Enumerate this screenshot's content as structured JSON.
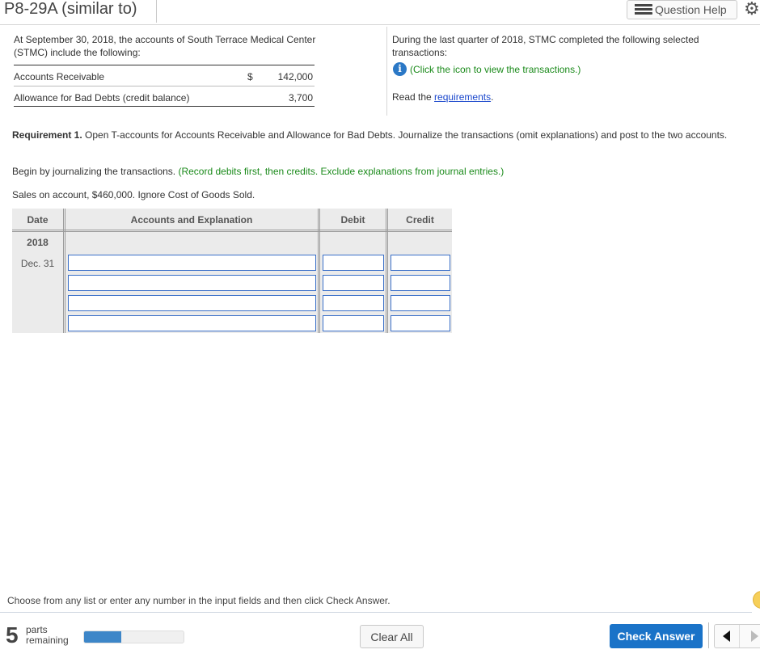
{
  "header": {
    "title": "P8-29A (similar to)",
    "question_help_label": "Question Help",
    "question_help_icon": "list-icon",
    "settings_icon": "gear-icon"
  },
  "left": {
    "intro": "At September 30, 2018, the accounts of South Terrace Medical Center (STMC) include the following:",
    "balances": [
      {
        "label": "Accounts Receivable",
        "currency": "$",
        "amount": "142,000"
      },
      {
        "label": "Allowance for Bad Debts (credit balance)",
        "currency": "",
        "amount": "3,700"
      }
    ]
  },
  "right": {
    "intro": "During the last quarter of 2018, STMC completed the following selected transactions:",
    "info_icon": "info-icon",
    "info_text": "(Click the icon to view the transactions.)",
    "read_prefix": "Read the ",
    "read_link": "requirements",
    "read_suffix": "."
  },
  "requirement": {
    "bold": "Requirement 1.",
    "text": " Open T-accounts for Accounts Receivable and Allowance for Bad Debts. Journalize the transactions (omit explanations) and post to the two accounts."
  },
  "begin": {
    "text": "Begin by journalizing the transactions. ",
    "hint": "(Record debits first, then credits. Exclude explanations from journal entries.)"
  },
  "transaction": "Sales on account, $460,000. Ignore Cost of Goods Sold.",
  "journal": {
    "headers": {
      "date": "Date",
      "accounts": "Accounts and Explanation",
      "debit": "Debit",
      "credit": "Credit"
    },
    "year": "2018",
    "date": "Dec. 31",
    "rows": [
      {
        "account": "",
        "debit": "",
        "credit": ""
      },
      {
        "account": "",
        "debit": "",
        "credit": ""
      },
      {
        "account": "",
        "debit": "",
        "credit": ""
      },
      {
        "account": "",
        "debit": "",
        "credit": ""
      }
    ]
  },
  "footer": {
    "note": "Choose from any list or enter any number in the input fields and then click Check Answer.",
    "parts_count": "5",
    "parts_label_1": "parts",
    "parts_label_2": "remaining",
    "progress_fraction": 0.37,
    "progress_color": "#3d86c8",
    "clear_all": "Clear All",
    "check_answer": "Check Answer",
    "check_answer_color": "#1a73c8"
  }
}
